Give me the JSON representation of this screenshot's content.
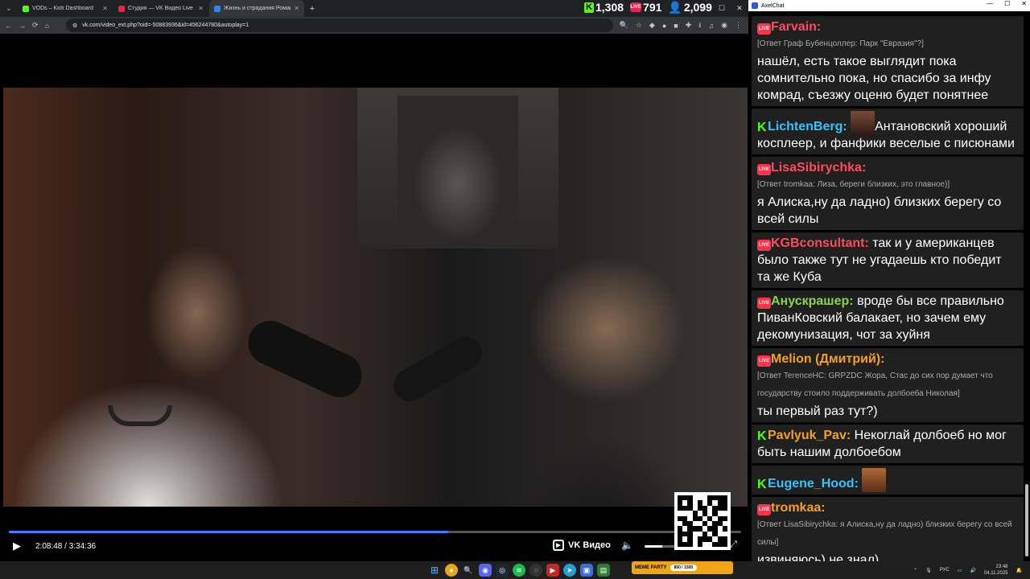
{
  "browser": {
    "tabs": [
      {
        "title": "VODs – Kick Dashboard",
        "color": "#53fc18",
        "active": false
      },
      {
        "title": "Студия — VK Видео Live",
        "color": "#e3254f",
        "active": false
      },
      {
        "title": "Жизнь и страдания Романа А",
        "color": "#2787f5",
        "active": true
      }
    ],
    "url": "vk.com/video_ext.php?oid=-50883936&id=456244780&autoplay=1"
  },
  "stats": {
    "kick_viewers": "1,308",
    "vk_viewers": "791",
    "total_viewers": "2,099"
  },
  "player": {
    "current_time": "2:08:48",
    "separator": "/",
    "duration": "3:34:36",
    "progress": 0.6,
    "volume": 0.55,
    "brand": "VK Видео"
  },
  "chat": {
    "app_title": "AxelChat",
    "messages": [
      {
        "platform": "vk",
        "user": "Farvain:",
        "color": "#ff4b5c",
        "reply": "[Ответ Граф Бубенцоллер: Парк \"Евразия\"?]",
        "text": "нашёл, есть такое выглядит пока сомнительно пока, но спасибо за инфу комрад, съезжу оценю будет понятнее"
      },
      {
        "platform": "kick",
        "user": "LichtenBerg:",
        "color": "#33c3ff",
        "emote": true,
        "text": "Антановский хороший косплеер, и фанфики веселые с писюнами"
      },
      {
        "platform": "vk",
        "user": "LisaSibirychka:",
        "color": "#ff4b5c",
        "reply": "[Ответ tromkaa: Лиза, береги близких, это главное)]",
        "text": "я Алиска,ну да ладно) близких берегу со всей силы"
      },
      {
        "platform": "vk",
        "user": "KGBconsultant:",
        "color": "#ff4b5c",
        "text": "так и у американцев было также тут не угадаешь кто победит та же Куба"
      },
      {
        "platform": "vk",
        "user": "Анускрашер:",
        "color": "#8bd14a",
        "text": "вроде бы все правильно ПиванКовский балакает, но зачем ему декомунизация, чот за хуйня"
      },
      {
        "platform": "vk",
        "user": "Melion (Дмитрий):",
        "color": "#f4a11d",
        "reply": "[Ответ TerenceHC: GRPZDC Жора, Стас до сих пор думает что государству стоило поддерживать долбоеба Николая]",
        "text": "ты первый раз тут?)"
      },
      {
        "platform": "kick",
        "user": "Pavlyuk_Pav:",
        "color": "#f4a11d",
        "text": "Некоглай долбоеб но мог быть нашим долбоебом"
      },
      {
        "platform": "kick",
        "user": "Eugene_Hood:",
        "color": "#33c3ff",
        "emote": true,
        "text": ""
      },
      {
        "platform": "vk",
        "user": "tromkaa:",
        "color": "#f4a11d",
        "reply": "[Ответ LisaSibirychka: я Алиска,ну да ладно) близких берегу со всей силы]",
        "text": "извиняюсь) не знал)"
      }
    ]
  },
  "taskbar": {
    "meme_label": "MEME PARTY",
    "meme_count": "850 / 1500",
    "lang": "РУС",
    "time": "23:48",
    "date": "04.11.2025"
  }
}
